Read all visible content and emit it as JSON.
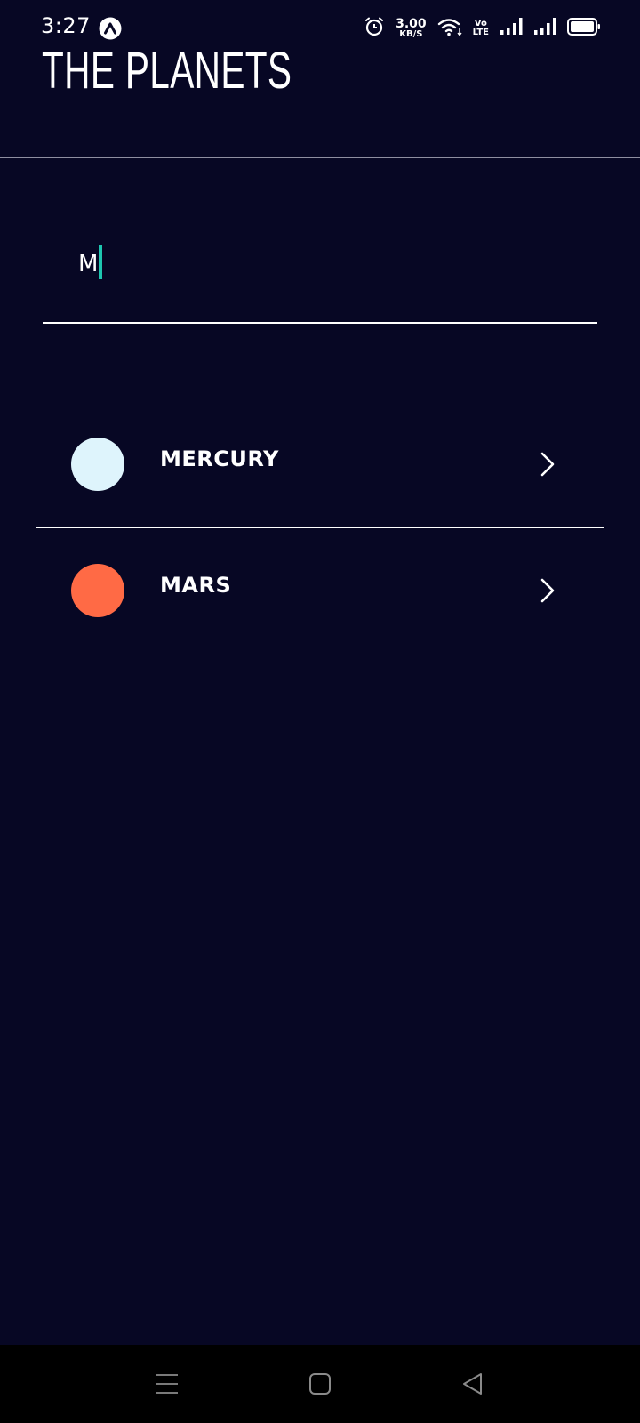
{
  "status_bar": {
    "time": "3:27",
    "net_speed_value": "3.00",
    "net_speed_unit": "KB/S",
    "volte_top": "Vo",
    "volte_bottom": "LTE"
  },
  "header": {
    "title": "THE PLANETS"
  },
  "search": {
    "value": "M",
    "placeholder": ""
  },
  "planets": [
    {
      "name": "MERCURY",
      "color": "#DEF4FC"
    },
    {
      "name": "MARS",
      "color": "#FF6A45"
    }
  ],
  "colors": {
    "background": "#070724",
    "caret": "#1EC6B0",
    "text": "#FFFFFF"
  },
  "nav": {
    "icons": [
      "menu-icon",
      "home-icon",
      "back-icon"
    ]
  }
}
